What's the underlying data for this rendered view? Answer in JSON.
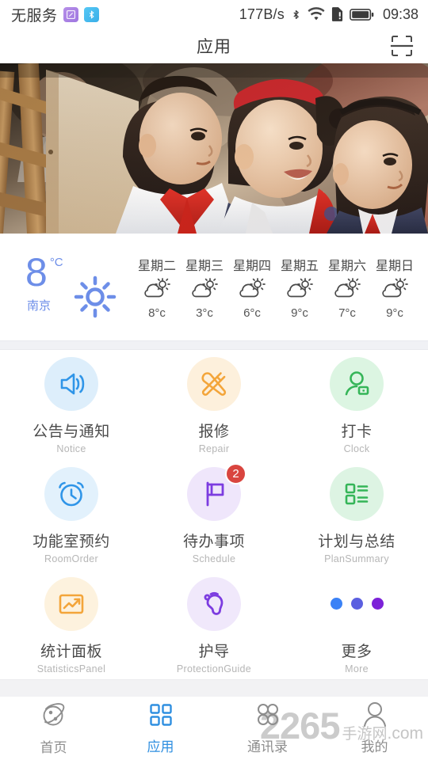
{
  "status_bar": {
    "carrier": "无服务",
    "chip1_icon": "screen-recorder-icon",
    "chip2_icon": "bluetooth-chip-icon",
    "network_speed": "177B/s",
    "bluetooth_icon": "bluetooth-icon",
    "wifi_icon": "wifi-icon",
    "sim_icon": "sim-card-icon",
    "battery_icon": "battery-icon",
    "time": "09:38"
  },
  "title_bar": {
    "title": "应用",
    "scan_icon": "scan-qr-icon"
  },
  "banner": {
    "alt": "school-children-at-easel-banner"
  },
  "weather": {
    "temperature": "8",
    "unit": "°C",
    "city": "南京",
    "current_icon": "sun-icon",
    "forecast": [
      {
        "day": "星期二",
        "icon": "partly-cloudy-icon",
        "temp": "8°c"
      },
      {
        "day": "星期三",
        "icon": "partly-cloudy-icon",
        "temp": "3°c"
      },
      {
        "day": "星期四",
        "icon": "partly-cloudy-icon",
        "temp": "6°c"
      },
      {
        "day": "星期五",
        "icon": "partly-cloudy-icon",
        "temp": "9°c"
      },
      {
        "day": "星期六",
        "icon": "partly-cloudy-icon",
        "temp": "7°c"
      },
      {
        "day": "星期日",
        "icon": "partly-cloudy-icon",
        "temp": "9°c"
      }
    ]
  },
  "apps": [
    {
      "label": "公告与通知",
      "sub": "Notice",
      "icon": "speaker-announcement-icon",
      "color": "#2f95e8",
      "bg": "#ddeefb",
      "badge": null
    },
    {
      "label": "报修",
      "sub": "Repair",
      "icon": "tools-wrench-hammer-icon",
      "color": "#f3a53a",
      "bg": "#fdf0dc",
      "badge": null
    },
    {
      "label": "打卡",
      "sub": "Clock",
      "icon": "person-card-icon",
      "color": "#35b558",
      "bg": "#dcf5e2",
      "badge": null
    },
    {
      "label": "功能室预约",
      "sub": "RoomOrder",
      "icon": "alarm-clock-icon",
      "color": "#2f95e8",
      "bg": "#e2f1fc",
      "badge": null
    },
    {
      "label": "待办事项",
      "sub": "Schedule",
      "icon": "flag-icon",
      "color": "#7c3ce0",
      "bg": "#efe6fb",
      "badge": "2"
    },
    {
      "label": "计划与总结",
      "sub": "PlanSummary",
      "icon": "checklist-icon",
      "color": "#35b558",
      "bg": "#ddf4e3",
      "badge": null
    },
    {
      "label": "统计面板",
      "sub": "StatisticsPanel",
      "icon": "chart-trending-icon",
      "color": "#f3a53a",
      "bg": "#fdf2de",
      "badge": null
    },
    {
      "label": "护导",
      "sub": "ProtectionGuide",
      "icon": "footprint-guide-icon",
      "color": "#7c3ce0",
      "bg": "#f0e8fb",
      "badge": null
    },
    {
      "label": "更多",
      "sub": "More",
      "icon": "three-dots-icon",
      "color": "#5b5fe0",
      "bg": "transparent",
      "badge": null,
      "dot_colors": [
        "#3b82f6",
        "#5b5fe0",
        "#7c22d8"
      ]
    }
  ],
  "bottom_nav": {
    "items": [
      {
        "label": "首页",
        "icon": "planet-home-icon",
        "active": false
      },
      {
        "label": "应用",
        "icon": "grid-apps-icon",
        "active": true
      },
      {
        "label": "通讯录",
        "icon": "contacts-icon",
        "active": false
      },
      {
        "label": "我的",
        "icon": "person-profile-icon",
        "active": false
      }
    ],
    "active_color": "#2f8fe0",
    "inactive_color": "#8d8d8d"
  },
  "watermark": {
    "number": "2265",
    "cn": "手游网",
    "com": ".com"
  }
}
